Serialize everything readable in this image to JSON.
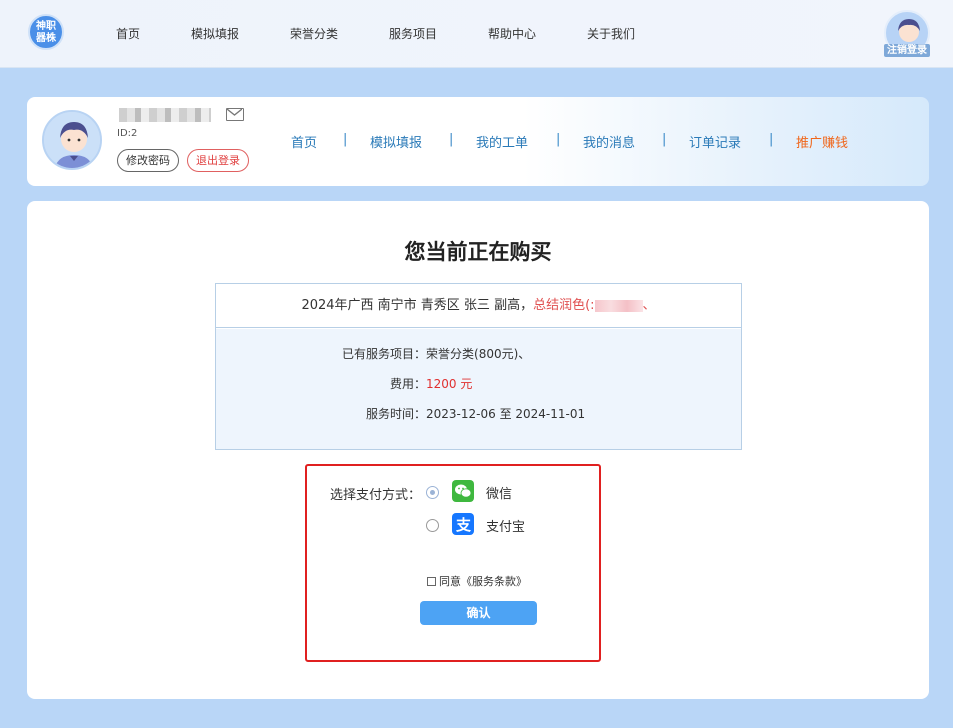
{
  "header": {
    "logo_text": "神职器株",
    "nav": [
      "首页",
      "模拟填报",
      "荣誉分类",
      "服务项目",
      "帮助中心",
      "关于我们"
    ],
    "user_label": "注销登录"
  },
  "profile": {
    "user_id": "ID:2",
    "change_password": "修改密码",
    "logout": "退出登录",
    "subnav": [
      "首页",
      "模拟填报",
      "我的工单",
      "我的消息",
      "订单记录",
      "推广赚钱"
    ],
    "separator": "|"
  },
  "purchase": {
    "title": "您当前正在购买",
    "order_head_prefix": "2024年广西 南宁市 青秀区 张三 副高，",
    "order_head_highlight": "总结润色(:",
    "order_head_suffix": "、",
    "services_label": "已有服务项目：",
    "services_value": "荣誉分类(800元)、",
    "fee_label": "费用：",
    "fee_value": "1200 元",
    "time_label": "服务时间：",
    "time_value": "2023-12-06 至 2024-11-01"
  },
  "payment": {
    "label": "选择支付方式：",
    "options": [
      {
        "name": "微信",
        "icon": "wechat-icon",
        "selected": true
      },
      {
        "name": "支付宝",
        "icon": "alipay-icon",
        "selected": false
      }
    ],
    "agree_text": "同意《服务条款》",
    "confirm": "确认"
  },
  "colors": {
    "page_bg": "#b9d6f7",
    "accent_blue": "#2a7ab8",
    "promo_orange": "#f0661a",
    "price_red": "#e03030",
    "highlight_frame": "#e02020",
    "confirm_btn": "#4da3f4"
  }
}
